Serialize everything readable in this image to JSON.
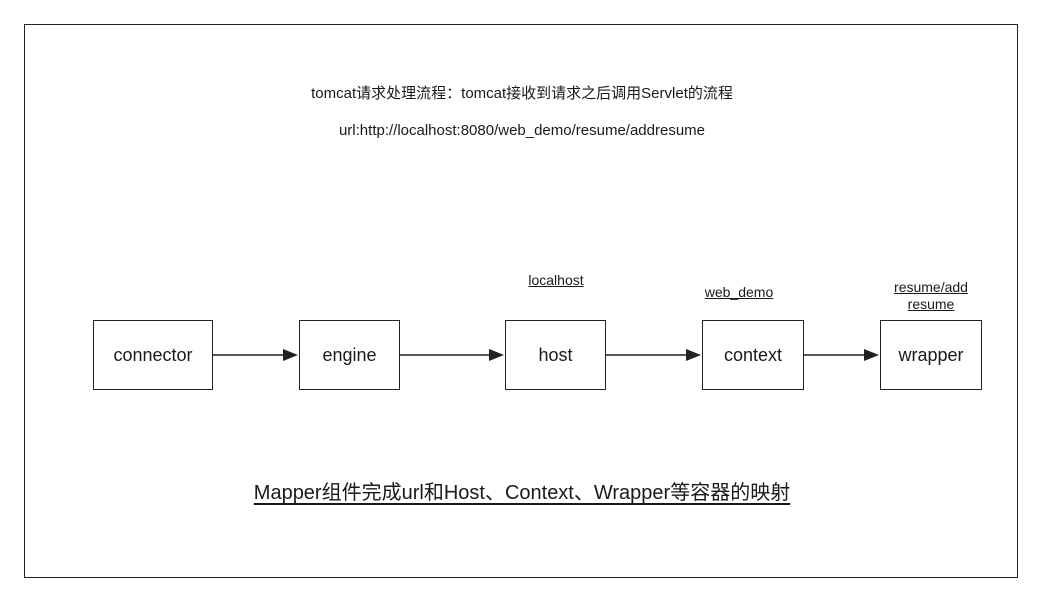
{
  "title_line1": "tomcat请求处理流程：tomcat接收到请求之后调用Servlet的流程",
  "title_line2": "url:http://localhost:8080/web_demo/resume/addresume",
  "nodes": {
    "connector": "connector",
    "engine": "engine",
    "host": "host",
    "context": "context",
    "wrapper": "wrapper"
  },
  "labels": {
    "host": "localhost",
    "context": "web_demo",
    "wrapper_line1": "resume/add",
    "wrapper_line2": "resume"
  },
  "note": "Mapper组件完成url和Host、Context、Wrapper等容器的映射",
  "colors": {
    "stroke": "#222222",
    "background": "#ffffff"
  }
}
